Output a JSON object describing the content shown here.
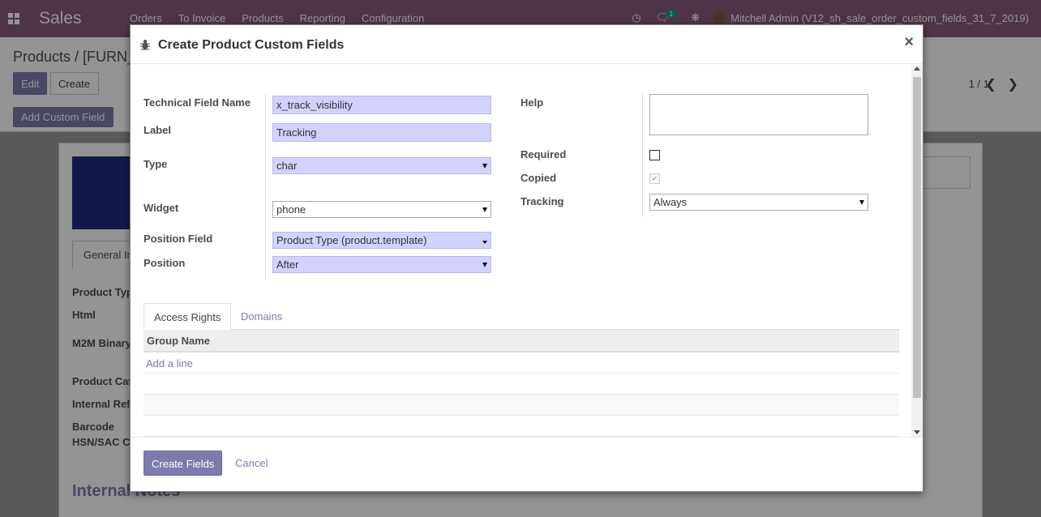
{
  "navbar": {
    "brand": "Sales",
    "menu": [
      "Orders",
      "To Invoice",
      "Products",
      "Reporting",
      "Configuration"
    ],
    "chat_badge": "1",
    "user": "Mitchell Admin (V12_sh_sale_order_custom_fields_31_7_2019)"
  },
  "control_panel": {
    "breadcrumb": "Products / [FURN_",
    "edit_label": "Edit",
    "create_label": "Create",
    "pager": "1 / 1",
    "add_custom_field_label": "Add Custom Field"
  },
  "sheet": {
    "tab_general": "General In",
    "labels": [
      "Product Typ",
      "Html",
      "M2M Binary",
      "Product Cat",
      "Internal Ref",
      "Barcode",
      "HSN/SAC C"
    ],
    "notes_title": "Internal Notes"
  },
  "modal": {
    "title": "Create Product Custom Fields",
    "close": "×",
    "fields": {
      "technical_name": {
        "label": "Technical Field Name",
        "value": "x_track_visibility"
      },
      "label": {
        "label": "Label",
        "value": "Tracking"
      },
      "type": {
        "label": "Type",
        "value": "char"
      },
      "widget": {
        "label": "Widget",
        "value": "phone"
      },
      "position_field": {
        "label": "Position Field",
        "value": "Product Type (product.template)"
      },
      "position": {
        "label": "Position",
        "value": "After"
      },
      "help": {
        "label": "Help",
        "value": ""
      },
      "required": {
        "label": "Required",
        "checked": false
      },
      "copied": {
        "label": "Copied",
        "checked": true
      },
      "tracking": {
        "label": "Tracking",
        "value": "Always"
      }
    },
    "tabs": [
      "Access Rights",
      "Domains"
    ],
    "grid": {
      "column": "Group Name",
      "add_line": "Add a line"
    },
    "footer": {
      "create_label": "Create Fields",
      "cancel_label": "Cancel"
    }
  },
  "colors": {
    "navbar": "#875a7b",
    "primary": "#7c7bad",
    "required_field": "#d2d2ff"
  }
}
